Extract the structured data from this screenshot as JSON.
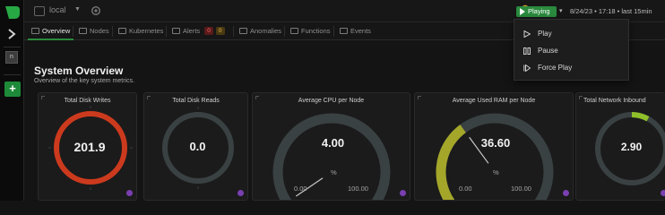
{
  "topbar": {
    "context": "local",
    "playing_label": "Playing",
    "time_range": "8/24/23 • 17:18 • last 15min"
  },
  "rail": {
    "node_button": "n",
    "add_button": "+"
  },
  "tabs": [
    {
      "label": "Overview",
      "active": true,
      "icon": "overview-icon"
    },
    {
      "label": "Nodes",
      "icon": "nodes-icon"
    },
    {
      "label": "Kubernetes",
      "icon": "kubernetes-icon"
    },
    {
      "label": "Alerts",
      "icon": "bell-icon",
      "badges": [
        "0",
        "0"
      ]
    },
    {
      "label": "Anomalies",
      "icon": "anomalies-icon"
    },
    {
      "label": "Functions",
      "icon": "functions-icon"
    },
    {
      "label": "Events",
      "icon": "events-icon"
    }
  ],
  "overview": {
    "title": "System Overview",
    "subtitle": "Overview of the key system metrics."
  },
  "play_menu": {
    "items": [
      "Play",
      "Pause",
      "Force Play"
    ]
  },
  "panels": [
    {
      "title": "Total Disk Writes",
      "value": "201.9"
    },
    {
      "title": "Total Disk Reads",
      "value": "0.0"
    },
    {
      "title": "Average CPU per Node",
      "value": "4.00",
      "unit": "%",
      "min": "0.00",
      "max": "100.00",
      "fraction": 0.04,
      "fill": "#3b5bd6"
    },
    {
      "title": "Average Used RAM per Node",
      "value": "36.60",
      "unit": "%",
      "min": "0.00",
      "max": "100.00",
      "fraction": 0.366,
      "fill": "#a4a62a"
    },
    {
      "title": "Total Network Inbound",
      "value": "2.90"
    }
  ],
  "colors": {
    "accent_green": "#2a8a3e",
    "disk_write_ring": "#cc3a1e",
    "gauge_track": "#3a4143"
  }
}
